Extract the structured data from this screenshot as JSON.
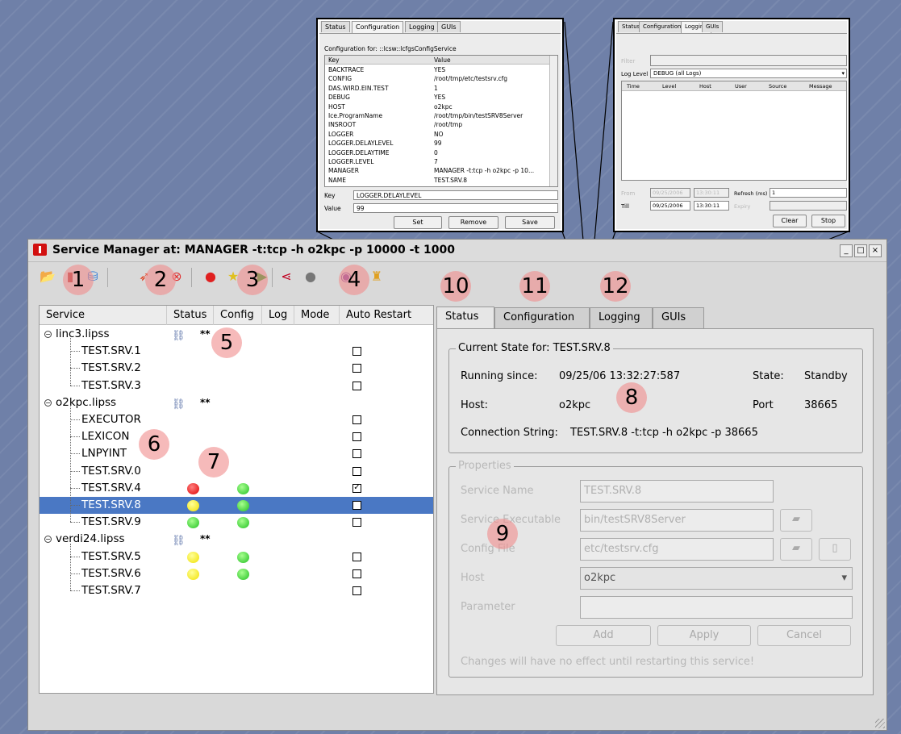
{
  "config_inset": {
    "tabs": [
      "Status",
      "Configuration",
      "Logging",
      "GUIs"
    ],
    "heading": "Configuration for: ::lcsw::lcfgsConfigService",
    "col_key": "Key",
    "col_value": "Value",
    "rows": [
      [
        "BACKTRACE",
        "YES"
      ],
      [
        "CONFIG",
        "/root/tmp/etc/testsrv.cfg"
      ],
      [
        "DAS.WIRD.EIN.TEST",
        "1"
      ],
      [
        "DEBUG",
        "YES"
      ],
      [
        "HOST",
        "o2kpc"
      ],
      [
        "Ice.ProgramName",
        "/root/tmp/bin/testSRV8Server"
      ],
      [
        "INSROOT",
        "/root/tmp"
      ],
      [
        "LOGGER",
        "NO"
      ],
      [
        "LOGGER.DELAYLEVEL",
        "99"
      ],
      [
        "LOGGER.DELAYTIME",
        "0"
      ],
      [
        "LOGGER.LEVEL",
        "7"
      ],
      [
        "MANAGER",
        "MANAGER -t:tcp -h o2kpc -p 10..."
      ],
      [
        "NAME",
        "TEST.SRV.8"
      ]
    ],
    "key_label": "Key",
    "key_value": "LOGGER.DELAYLEVEL",
    "value_label": "Value",
    "value_value": "99",
    "buttons": [
      "Set",
      "Remove",
      "Save"
    ]
  },
  "logging_inset": {
    "tabs": [
      "Status",
      "Configuration",
      "Logging",
      "GUIs"
    ],
    "filter_label": "Filter",
    "log_level_label": "Log Level",
    "log_level_value": "DEBUG (all Logs)",
    "columns": [
      "Time",
      "Level",
      "Host",
      "User",
      "Source",
      "Message"
    ],
    "from_label": "From",
    "from_date": "09/25/2006",
    "from_time": "13:30:11",
    "refresh_label": "Refresh (ms)",
    "refresh_value": "1",
    "till_label": "Till",
    "till_date": "09/25/2006",
    "till_time": "13:30:11",
    "expiry_label": "Expiry",
    "buttons": [
      "Clear",
      "Stop"
    ]
  },
  "window": {
    "title": "Service Manager at: MANAGER -t:tcp -h o2kpc -p 10000 -t 1000",
    "controls": [
      "_",
      "□",
      "×"
    ]
  },
  "callouts": [
    "1",
    "2",
    "3",
    "4",
    "5",
    "6",
    "7",
    "8",
    "9",
    "10",
    "11",
    "12"
  ],
  "tree": {
    "columns": [
      "Service",
      "Status",
      "Config",
      "Log",
      "Mode",
      "Auto Restart"
    ],
    "hosts": [
      {
        "name": "linc3.lipss",
        "marker": "**",
        "services": [
          {
            "name": "TEST.SRV.1",
            "status": "",
            "config": "",
            "checked": false
          },
          {
            "name": "TEST.SRV.2",
            "status": "",
            "config": "",
            "checked": false
          },
          {
            "name": "TEST.SRV.3",
            "status": "",
            "config": "",
            "checked": false
          }
        ]
      },
      {
        "name": "o2kpc.lipss",
        "marker": "**",
        "services": [
          {
            "name": "EXECUTOR",
            "status": "",
            "config": "",
            "checked": false
          },
          {
            "name": "LEXICON",
            "status": "",
            "config": "",
            "checked": false
          },
          {
            "name": "LNPYINT",
            "status": "",
            "config": "",
            "checked": false
          },
          {
            "name": "TEST.SRV.0",
            "status": "",
            "config": "",
            "checked": false
          },
          {
            "name": "TEST.SRV.4",
            "status": "red",
            "config": "green",
            "checked": true
          },
          {
            "name": "TEST.SRV.8",
            "status": "yellow",
            "config": "green",
            "checked": false,
            "selected": true
          },
          {
            "name": "TEST.SRV.9",
            "status": "green",
            "config": "green",
            "checked": false
          }
        ]
      },
      {
        "name": "verdi24.lipss",
        "marker": "**",
        "services": [
          {
            "name": "TEST.SRV.5",
            "status": "yellow",
            "config": "green",
            "checked": false
          },
          {
            "name": "TEST.SRV.6",
            "status": "yellow",
            "config": "green",
            "checked": false
          },
          {
            "name": "TEST.SRV.7",
            "status": "",
            "config": "",
            "checked": false
          }
        ]
      }
    ],
    "checkmark": "✓"
  },
  "tabs": [
    "Status",
    "Configuration",
    "Logging",
    "GUIs"
  ],
  "current_state": {
    "title": "Current State for: TEST.SRV.8",
    "running_since_label": "Running since:",
    "running_since_value": "09/25/06 13:32:27:587",
    "state_label": "State:",
    "state_value": "Standby",
    "host_label": "Host:",
    "host_value": "o2kpc",
    "port_label": "Port",
    "port_value": "38665",
    "conn_label": "Connection String:",
    "conn_value": "TEST.SRV.8 -t:tcp -h o2kpc -p 38665"
  },
  "properties": {
    "title": "Properties",
    "service_name_label": "Service Name",
    "service_name_value": "TEST.SRV.8",
    "executable_label": "Service Executable",
    "executable_value": "bin/testSRV8Server",
    "config_file_label": "Config File",
    "config_file_value": "etc/testsrv.cfg",
    "host_label": "Host",
    "host_value": "o2kpc",
    "parameter_label": "Parameter",
    "parameter_value": "",
    "buttons": [
      "Add",
      "Apply",
      "Cancel"
    ],
    "note": "Changes will have no effect until restarting this service!"
  },
  "colors": {
    "selection": "#4a78c4",
    "callout": "#f08c8c",
    "desktop": "#6f80a8"
  }
}
